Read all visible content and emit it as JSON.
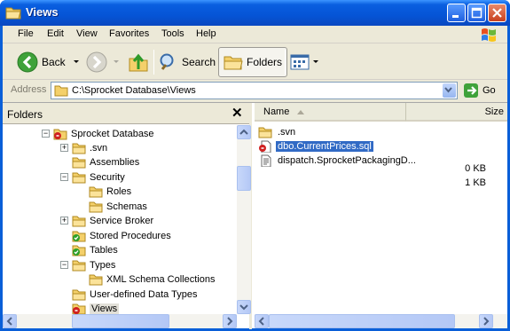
{
  "window": {
    "title": "Views"
  },
  "menu": [
    "File",
    "Edit",
    "View",
    "Favorites",
    "Tools",
    "Help"
  ],
  "toolbar": {
    "back_label": "Back",
    "search_label": "Search",
    "folders_label": "Folders"
  },
  "address": {
    "label": "Address",
    "value": "C:\\Sprocket Database\\Views",
    "go_label": "Go"
  },
  "folders_pane": {
    "title": "Folders",
    "close_glyph": "✕"
  },
  "tree": [
    {
      "label": "Sprocket Database",
      "icon": "database-folder-icon",
      "expander": "−"
    },
    {
      "label": ".svn",
      "icon": "folder-icon",
      "expander": "+"
    },
    {
      "label": "Assemblies",
      "icon": "folder-icon",
      "expander": ""
    },
    {
      "label": "Security",
      "icon": "folder-icon",
      "expander": "−"
    },
    {
      "label": "Roles",
      "icon": "folder-icon",
      "expander": ""
    },
    {
      "label": "Schemas",
      "icon": "folder-icon",
      "expander": ""
    },
    {
      "label": "Service Broker",
      "icon": "folder-icon",
      "expander": "+"
    },
    {
      "label": "Stored Procedures",
      "icon": "modified-folder-icon",
      "expander": ""
    },
    {
      "label": "Tables",
      "icon": "modified-folder-icon",
      "expander": ""
    },
    {
      "label": "Types",
      "icon": "folder-icon",
      "expander": "−"
    },
    {
      "label": "XML Schema Collections",
      "icon": "folder-icon",
      "expander": ""
    },
    {
      "label": "User-defined Data Types",
      "icon": "folder-icon",
      "expander": ""
    },
    {
      "label": "Views",
      "icon": "database-folder-icon",
      "expander": ""
    }
  ],
  "list": {
    "columns": {
      "name": "Name",
      "size": "Size"
    },
    "rows": [
      {
        "name": ".svn",
        "size": "",
        "icon": "folder-icon"
      },
      {
        "name": "dbo.CurrentPrices.sql",
        "size": "0 KB",
        "icon": "sql-file-icon"
      },
      {
        "name": "dispatch.SprocketPackagingD...",
        "size": "1 KB",
        "icon": "sql-file-icon"
      }
    ]
  },
  "colors": {
    "titlebar": "#0554d6",
    "selection": "#316ac5",
    "chrome": "#ece9d8"
  }
}
